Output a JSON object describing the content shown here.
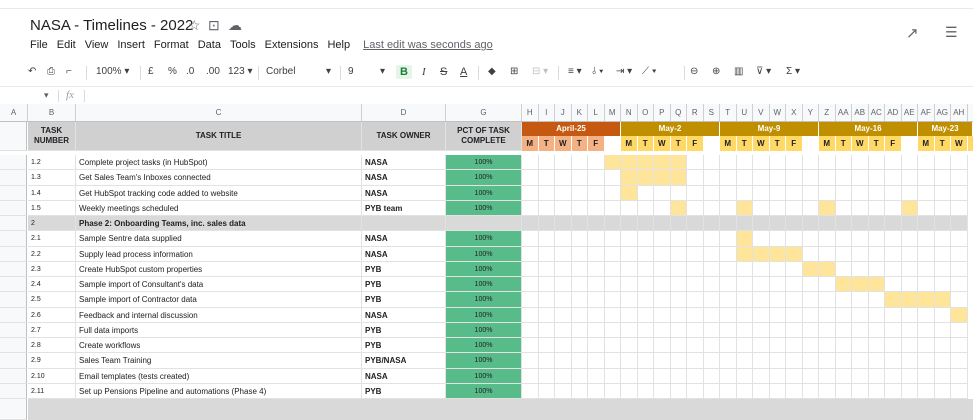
{
  "doc": {
    "title": "NASA - Timelines - 2022"
  },
  "menu": {
    "items": [
      "File",
      "Edit",
      "View",
      "Insert",
      "Format",
      "Data",
      "Tools",
      "Extensions",
      "Help"
    ],
    "last_edit": "Last edit was seconds ago"
  },
  "toolbar": {
    "zoom": "100%",
    "currency": "£",
    "percent": "%",
    "dec_less": ".0",
    "dec_more": ".00",
    "format": "123",
    "font": "Corbel",
    "size": "9",
    "bold": "B",
    "italic": "I",
    "strike": "S",
    "textcolor": "A"
  },
  "formula": {
    "fx": "fx"
  },
  "columns": [
    "A",
    "B",
    "C",
    "D",
    "G",
    "H",
    "I",
    "J",
    "K",
    "L",
    "M",
    "N",
    "O",
    "P",
    "Q",
    "R",
    "S",
    "T",
    "U",
    "V",
    "W",
    "X",
    "Y",
    "Z",
    "AA",
    "AB",
    "AC",
    "AD",
    "AE",
    "AF",
    "AG",
    "AH"
  ],
  "headers": {
    "task_number": "TASK NUMBER",
    "task_title": "TASK TITLE",
    "task_owner": "TASK OWNER",
    "pct_complete": "PCT OF TASK COMPLETE"
  },
  "weeks": [
    {
      "label": "April-25",
      "color": "#c65911"
    },
    {
      "label": "May-2",
      "color": "#bf8f00"
    },
    {
      "label": "May-9",
      "color": "#bf8f00"
    },
    {
      "label": "May-16",
      "color": "#bf8f00"
    },
    {
      "label": "May-23",
      "color": "#bf8f00"
    }
  ],
  "day_letters": [
    "M",
    "T",
    "W",
    "T",
    "F"
  ],
  "colors": {
    "gantt_bar": "#ffe599",
    "pct_fill": "#57bb8a",
    "header_grey": "#d0d0d0",
    "day_april": "#f4b183",
    "day_may": "#ffd966",
    "phase_row": "#d9d9d9"
  },
  "rows": [
    {
      "num": "1.2",
      "title": "Complete project tasks (in HubSpot)",
      "owner": "NASA",
      "pct": "100%",
      "bars": [
        5,
        10
      ]
    },
    {
      "num": "1.3",
      "title": "Get Sales Team's Inboxes connected",
      "owner": "NASA",
      "pct": "100%",
      "bars": [
        6,
        10
      ]
    },
    {
      "num": "1.4",
      "title": "Get HubSpot tracking code added to website",
      "owner": "NASA",
      "pct": "100%",
      "bars": [
        6,
        7
      ]
    },
    {
      "num": "1.5",
      "title": "Weekly meetings scheduled",
      "owner": "PYB team",
      "pct": "100%",
      "bars": [
        9,
        10,
        13,
        14,
        18,
        19,
        23,
        24
      ]
    },
    {
      "num": "2",
      "title": "Phase 2: Onboarding Teams, inc. sales data",
      "owner": "",
      "pct": "",
      "phase": true,
      "bars": []
    },
    {
      "num": "2.1",
      "title": "Sample Sentre data supplied",
      "owner": "NASA",
      "pct": "100%",
      "bars": [
        13,
        14
      ]
    },
    {
      "num": "2.2",
      "title": "Supply lead process information",
      "owner": "NASA",
      "pct": "100%",
      "bars": [
        13,
        17
      ]
    },
    {
      "num": "2.3",
      "title": "Create HubSpot custom properties",
      "owner": "PYB",
      "pct": "100%",
      "bars": [
        17,
        19
      ]
    },
    {
      "num": "2.4",
      "title": "Sample import of Consultant's data",
      "owner": "PYB",
      "pct": "100%",
      "bars": [
        19,
        22
      ]
    },
    {
      "num": "2.5",
      "title": "Sample import of Contractor data",
      "owner": "PYB",
      "pct": "100%",
      "bars": [
        22,
        26
      ]
    },
    {
      "num": "2.6",
      "title": "Feedback and internal discussion",
      "owner": "NASA",
      "pct": "100%",
      "bars": [
        26,
        27
      ]
    },
    {
      "num": "2.7",
      "title": "Full data imports",
      "owner": "PYB",
      "pct": "100%",
      "bars": []
    },
    {
      "num": "2.8",
      "title": "Create workflows",
      "owner": "PYB",
      "pct": "100%",
      "bars": []
    },
    {
      "num": "2.9",
      "title": "Sales Team Training",
      "owner": "PYB/NASA",
      "pct": "100%",
      "bars": []
    },
    {
      "num": "2.10",
      "title": "Email templates (tests created)",
      "owner": "NASA",
      "pct": "100%",
      "bars": []
    },
    {
      "num": "2.11",
      "title": "Set up Pensions Pipeline and automations (Phase 4)",
      "owner": "PYB",
      "pct": "100%",
      "bars": []
    }
  ]
}
